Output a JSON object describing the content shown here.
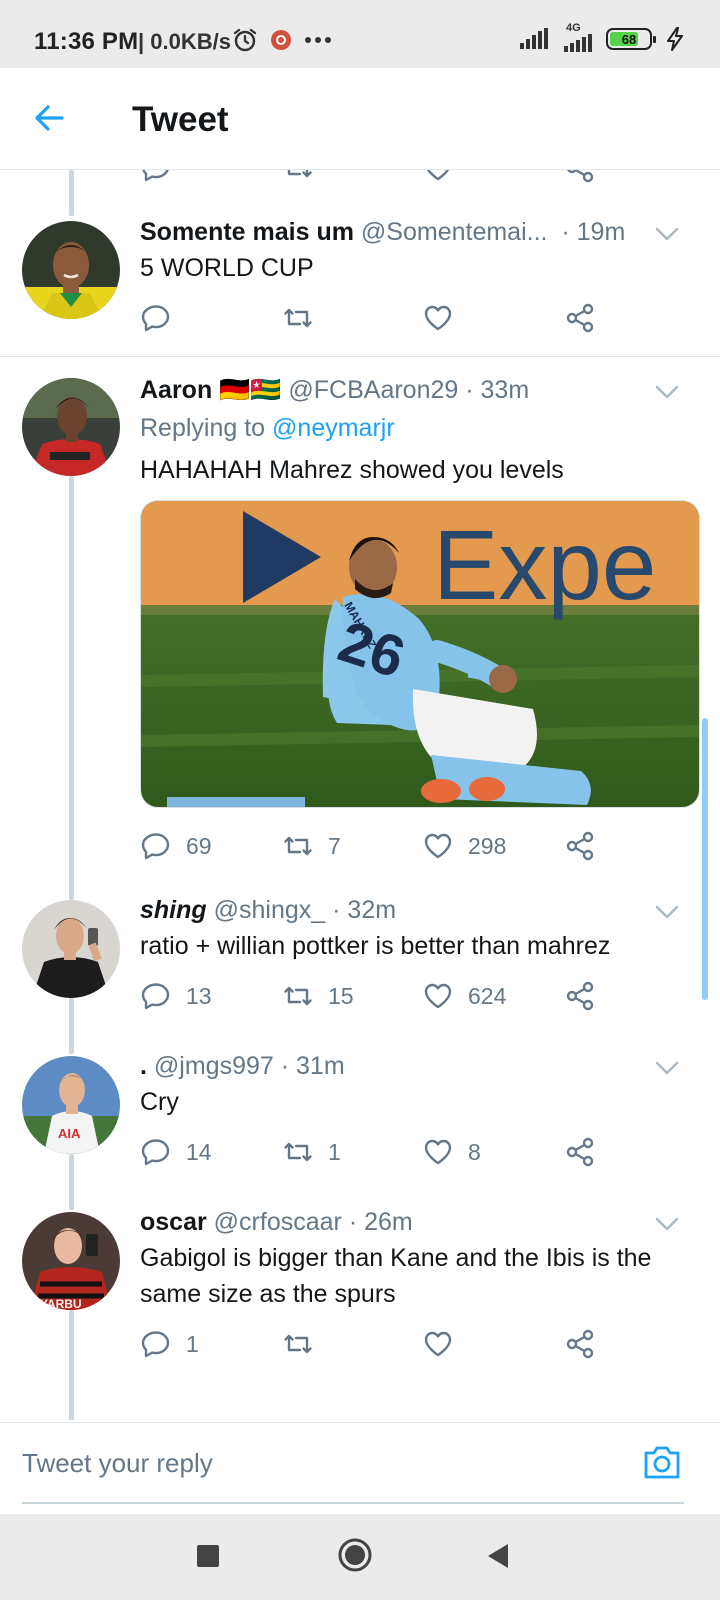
{
  "status_bar": {
    "time": "11:36 PM",
    "speed": "| 0.0KB/s",
    "network": "4G",
    "battery": "68",
    "icons": [
      "alarm-icon",
      "app-notification-icon",
      "more-dots-icon",
      "signal-icon",
      "battery-icon",
      "charging-icon"
    ]
  },
  "header": {
    "title": "Tweet",
    "back_icon": "arrow-left-icon"
  },
  "tweets": [
    {
      "name": "Somente mais um",
      "handle": "@Somentemai...",
      "time": "· 19m",
      "text": "5 WORLD CUP",
      "reply_count": "",
      "retweet_count": "",
      "like_count": ""
    },
    {
      "name": "Aaron 🇩🇪🇹🇬",
      "handle": "@FCBAaron29",
      "time": "· 33m",
      "replying_prefix": "Replying to",
      "replying_to": "@neymarjr",
      "text": "HAHAHAH Mahrez showed you levels",
      "media_text": "Expe",
      "jersey_name": "MAHREZ",
      "jersey_number": "26",
      "reply_count": "69",
      "retweet_count": "7",
      "like_count": "298"
    },
    {
      "name": "shing",
      "handle": "@shingx_",
      "time": "· 32m",
      "text": "ratio + willian pottker is better than mahrez",
      "reply_count": "13",
      "retweet_count": "15",
      "like_count": "624"
    },
    {
      "name": ".",
      "handle": "@jmgs997",
      "time": "· 31m",
      "text": "Cry",
      "jersey_text": "AIA",
      "reply_count": "14",
      "retweet_count": "1",
      "like_count": "8"
    },
    {
      "name": "oscar",
      "handle": "@crfoscaar",
      "time": "· 26m",
      "text": "Gabigol is bigger than Kane and the Ibis is the same size as the spurs",
      "shirt_text": "YARBU",
      "reply_count": "1",
      "retweet_count": "",
      "like_count": ""
    }
  ],
  "composer": {
    "placeholder": "Tweet your reply"
  },
  "colors": {
    "accent": "#1da1f2",
    "text": "#14171a",
    "secondary": "#657786",
    "divider": "#e1e8ed"
  }
}
